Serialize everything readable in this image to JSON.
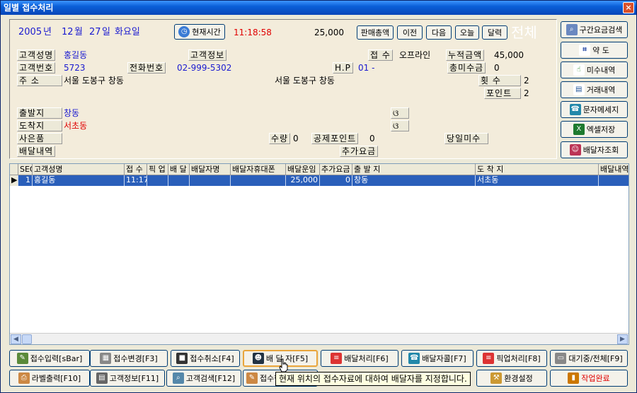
{
  "window": {
    "title": "일별 접수처리",
    "close": "×"
  },
  "header": {
    "year": "2005",
    "year_unit": "년",
    "month": "12",
    "month_unit": "월",
    "day": "27",
    "day_unit": "일",
    "weekday": "화요일",
    "now_btn": "현재시간",
    "clock": "11:18:58",
    "amount": "25,000",
    "sales_total": "판매총액",
    "prev": "이전",
    "next": "다음",
    "today": "오늘",
    "calendar": "달력",
    "all": "전체"
  },
  "form": {
    "name_label": "고객성명",
    "name": "홍길동",
    "info_label": "고객정보",
    "receipt_label": "접 수",
    "receipt": "오프라인",
    "cum_label": "누적금액",
    "cum": "45,000",
    "no_label": "고객번호",
    "no": "5723",
    "phone_label": "전화번호",
    "phone": "02-999-5302",
    "hp_label": "H.P",
    "hp": "01 -",
    "unpaid_label": "총미수금",
    "unpaid": "0",
    "addr_label": "주 소",
    "addr": "서울 도봉구 창동",
    "addr2": "서울 도봉구 창동",
    "count_label": "횟 수",
    "count": "2",
    "point_label": "포인트",
    "point": "2",
    "from_label": "출발지",
    "from": "창동",
    "from_mark": "ଓ",
    "to_label": "도착지",
    "to": "서초동",
    "to_mark": "ଓ",
    "goods_label": "사은품",
    "qty_label": "수량",
    "qty": "0",
    "deduct_label": "공제포인트",
    "deduct": "0",
    "today_unpaid_label": "당일미수",
    "detail_label": "배달내역",
    "extra_label": "추가요금"
  },
  "side": {
    "section_fee": "구간요금검색",
    "map": "약 도",
    "unpaid_list": "미수내역",
    "deals": "거래내역",
    "sms": "문자메세지",
    "excel": "엑셀저장",
    "courier": "배달자조회"
  },
  "table": {
    "headers": [
      "SEQ",
      "고객성명",
      "접 수",
      "픽 업",
      "배 달",
      "배달자명",
      "배달자휴대폰",
      "배달운임",
      "추가요금",
      "출 발 지",
      "도 착 지",
      "배달내역"
    ],
    "rows": [
      [
        "1",
        "홍길동",
        "11:17",
        "",
        "",
        "",
        "",
        "25,000",
        "0",
        "창동",
        "서초동",
        ""
      ]
    ]
  },
  "footer": {
    "b1": "접수입력[sBar]",
    "b2": "접수변경[F3]",
    "b3": "접수취소[F4]",
    "b4": "배 달 자[F5]",
    "b5": "배달처리[F6]",
    "b6": "배달자콜[F7]",
    "b7": "픽업처리[F8]",
    "b8": "대기중/전체[F9]",
    "c1": "라벨출력[F10]",
    "c2": "고객정보[F11]",
    "c3": "고객검색[F12]",
    "c4": "접수현",
    "c7": "환경설정",
    "c8": "작업완료"
  },
  "tooltip": "현재 위치의 접수자료에 대하여 배달자를 지정합니다."
}
